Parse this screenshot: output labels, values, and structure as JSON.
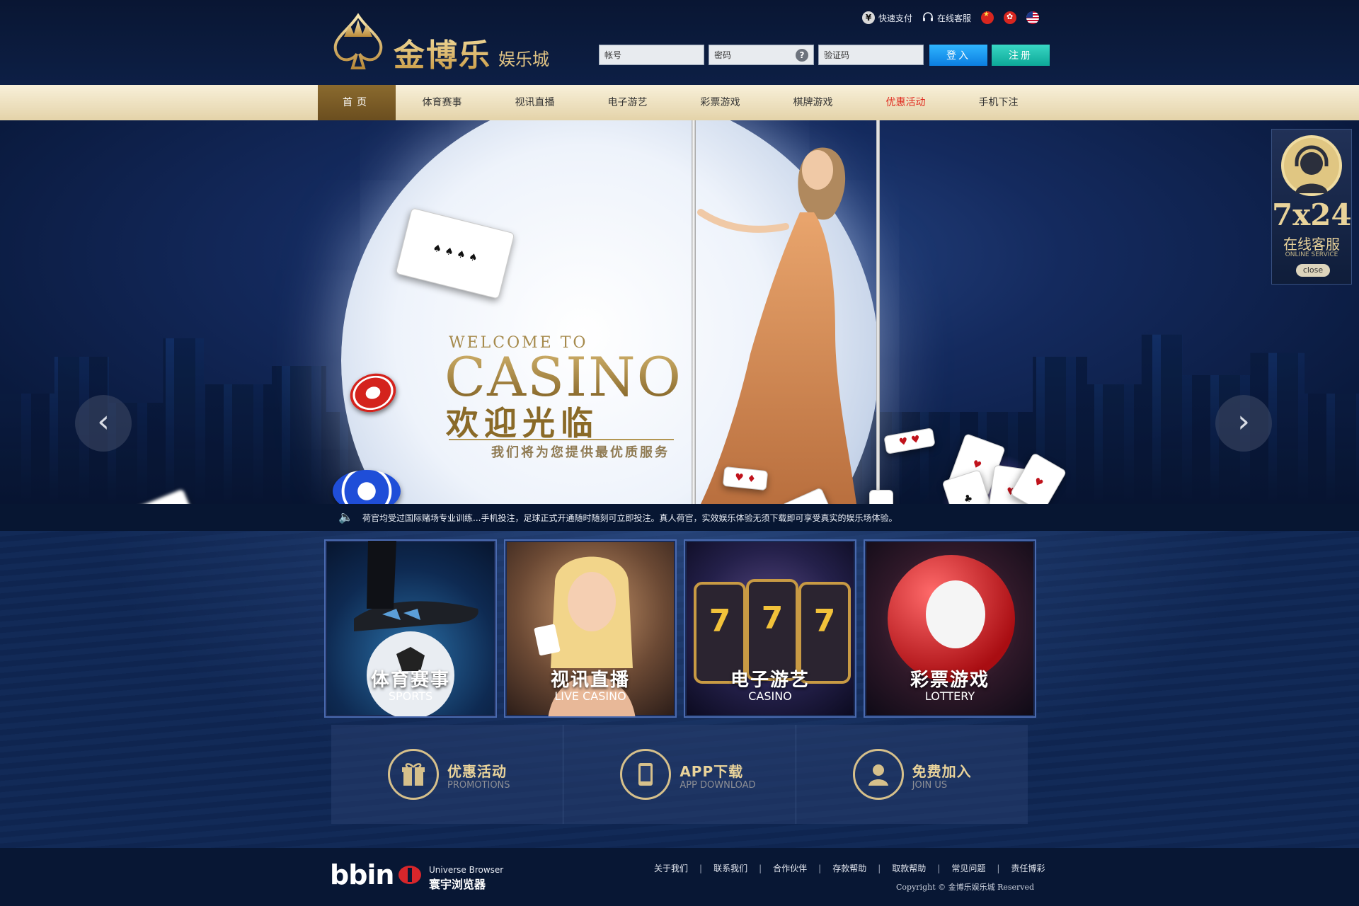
{
  "header": {
    "logo_main": "金博乐",
    "logo_sub": "娱乐城",
    "quick_pay": "快速支付",
    "online_support": "在线客服",
    "pay_icon_glyph": "¥",
    "login": {
      "account_placeholder": "帐号",
      "password_placeholder": "密码",
      "captcha_placeholder": "验证码",
      "help_glyph": "?",
      "login_label": "登入",
      "register_label": "注册"
    }
  },
  "nav": {
    "items": [
      {
        "label": "首页"
      },
      {
        "label": "体育赛事"
      },
      {
        "label": "视讯直播"
      },
      {
        "label": "电子游艺"
      },
      {
        "label": "彩票游戏"
      },
      {
        "label": "棋牌游戏"
      },
      {
        "label": "优惠活动"
      },
      {
        "label": "手机下注"
      }
    ]
  },
  "banner": {
    "welcome_to": "WELCOME TO",
    "casino": "CASINO",
    "welcome_cn": "欢迎光临",
    "tagline": "我们将为您提供最优质服务",
    "prev_glyph": "‹",
    "next_glyph": "›",
    "slides": 4,
    "active_slide": 1
  },
  "service": {
    "hours": "7x24",
    "title": "在线客服",
    "subtitle": "ONLINE SERVICE",
    "close_label": "close"
  },
  "notice": {
    "text": "荷官均受过国际赌场专业训练...手机投注，足球正式开通随时随刻可立即投注。真人荷官，实效娱乐体验无须下载即可享受真实的娱乐场体验。"
  },
  "tiles": [
    {
      "cn": "体育赛事",
      "en": "SPORTS"
    },
    {
      "cn": "视讯直播",
      "en": "LIVE CASINO"
    },
    {
      "cn": "电子游艺",
      "en": "CASINO"
    },
    {
      "cn": "彩票游戏",
      "en": "LOTTERY"
    }
  ],
  "features": [
    {
      "cn": "优惠活动",
      "en": "PROMOTIONS"
    },
    {
      "cn": "APP下载",
      "en": "APP DOWNLOAD"
    },
    {
      "cn": "免费加入",
      "en": "JOIN US"
    }
  ],
  "footer": {
    "bbin": "bbin",
    "browser_en": "Universe Browser",
    "browser_cn": "寰宇浏览器",
    "links": [
      "关于我们",
      "联系我们",
      "合作伙伴",
      "存款帮助",
      "取款帮助",
      "常见问题",
      "责任博彩"
    ],
    "separator": "|",
    "copyright": "Copyright © 金博乐娱乐城 Reserved"
  },
  "colors": {
    "gold": "#e0c383",
    "nav_bg": "#f1e5c4",
    "login_blue": "#1a9af0",
    "register_teal": "#1cbfae",
    "promo_red": "#e0281d"
  }
}
